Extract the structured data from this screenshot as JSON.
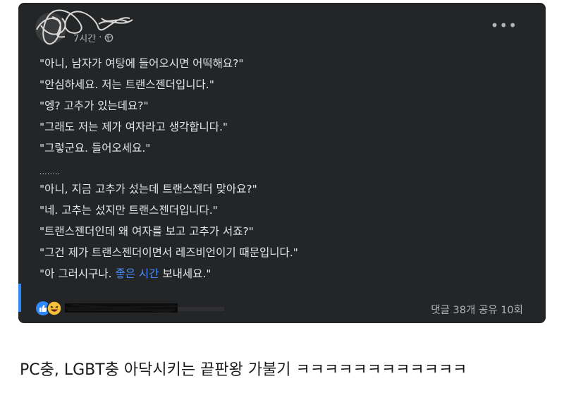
{
  "post": {
    "timestamp": "7시간",
    "lines": [
      "\"아니, 남자가 여탕에 들어오시면 어떡해요?\"",
      "\"안심하세요. 저는 트랜스젠더입니다.\"",
      "\"엥? 고추가 있는데요?\"",
      "\"그래도 저는 제가 여자라고 생각합니다.\"",
      "\"그렇군요. 들어오세요.\"",
      "........",
      "\"아니, 지금 고추가 섰는데 트랜스젠더 맞아요?\"",
      "\"네. 고추는 섰지만 트랜스젠더입니다.\"",
      "\"트랜스젠더인데 왜 여자를 보고 고추가 서죠?\"",
      "\"그건 제가 트랜스젠더이면서 레즈비언이기 때문입니다.\""
    ],
    "last_line": {
      "before": "\"아 그러시구나. ",
      "link": "좋은 시간",
      "after": " 보내세요.\""
    },
    "counts": "댓글 38개  공유 10회"
  },
  "caption": "PC충, LGBT충 아닥시키는 끝판왕 가불기 ㅋㅋㅋㅋㅋㅋㅋㅋㅋㅋㅋㅋ",
  "colors": {
    "post_bg": "#242526",
    "text": "#e4e6eb",
    "secondary": "#b0b3b8",
    "link": "#4a8cff"
  }
}
